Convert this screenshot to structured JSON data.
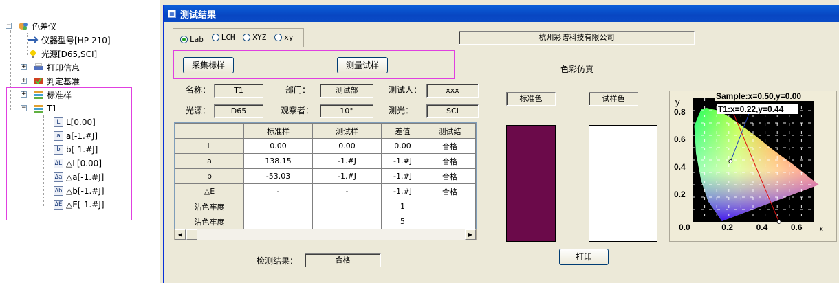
{
  "tree": {
    "root": "色差仪",
    "items": [
      {
        "label": "仪器型号[HP-210]",
        "icon": "usb-icon"
      },
      {
        "label": "光源[D65,SCI]",
        "icon": "bulb-icon"
      },
      {
        "label": "打印信息",
        "icon": "printer-icon"
      },
      {
        "label": "判定基准",
        "icon": "check-icon"
      },
      {
        "label": "标准样",
        "icon": "sample-icon"
      },
      {
        "label": "T1",
        "icon": "sample-icon"
      }
    ],
    "t1_children": [
      {
        "icon_text": "L",
        "label": "L[0.00]"
      },
      {
        "icon_text": "a",
        "label": "a[-1.#J]"
      },
      {
        "icon_text": "b",
        "label": "b[-1.#J]"
      },
      {
        "icon_text": "ΔL",
        "label": "△L[0.00]"
      },
      {
        "icon_text": "Δa",
        "label": "△a[-1.#J]"
      },
      {
        "icon_text": "Δb",
        "label": "△b[-1.#J]"
      },
      {
        "icon_text": "ΔE",
        "label": "△E[-1.#J]"
      }
    ]
  },
  "window": {
    "title": "测试结果"
  },
  "modes": [
    {
      "label": "Lab",
      "selected": true
    },
    {
      "label": "LCH",
      "selected": false
    },
    {
      "label": "XYZ",
      "selected": false
    },
    {
      "label": "xy",
      "selected": false
    }
  ],
  "company": "杭州彩谱科技有限公司",
  "buttons": {
    "collect_standard": "采集标样",
    "measure_sample": "测量试样",
    "print": "打印"
  },
  "info": {
    "name_label": "名称：",
    "name_value": "T1",
    "dept_label": "部门：",
    "dept_value": "测试部",
    "tester_label": "测试人：",
    "tester_value": "xxx",
    "light_label": "光源：",
    "light_value": "D65",
    "observer_label": "观察者：",
    "observer_value": "10°",
    "measure_label": "测光：",
    "measure_value": "SCI"
  },
  "table": {
    "headers": [
      "",
      "标准样",
      "测试样",
      "差值",
      "测试结"
    ],
    "rows": [
      [
        "L",
        "0.00",
        "0.00",
        "0.00",
        "合格"
      ],
      [
        "a",
        "138.15",
        "-1.#J",
        "-1.#J",
        "合格"
      ],
      [
        "b",
        "-53.03",
        "-1.#J",
        "-1.#J",
        "合格"
      ],
      [
        "△E",
        "-",
        "-",
        "-1.#J",
        "合格"
      ],
      [
        "沾色牢度",
        "",
        "",
        "1",
        ""
      ],
      [
        "沾色牢度",
        "",
        "",
        "5",
        ""
      ]
    ]
  },
  "result": {
    "label": "检测结果：",
    "value": "合格"
  },
  "simulation": {
    "title": "色彩仿真",
    "standard_label": "标准色",
    "sample_label": "试样色",
    "standard_color": "#6b0a4a",
    "sample_color": "#ffffff"
  },
  "chart_data": {
    "type": "scatter",
    "xlabel": "x",
    "ylabel": "y",
    "xlim": [
      0.0,
      0.7
    ],
    "ylim": [
      0.0,
      0.9
    ],
    "x_ticks": [
      "0.0",
      "0.2",
      "0.4",
      "0.6"
    ],
    "y_ticks": [
      "0.8",
      "0.6",
      "0.4",
      "0.2"
    ],
    "annotations": [
      "Sample:x=0.50,y=0.00",
      "T1:x=0.22,y=0.44"
    ],
    "points": [
      {
        "name": "Sample",
        "x": 0.5,
        "y": 0.0
      },
      {
        "name": "T1",
        "x": 0.22,
        "y": 0.44
      }
    ]
  }
}
